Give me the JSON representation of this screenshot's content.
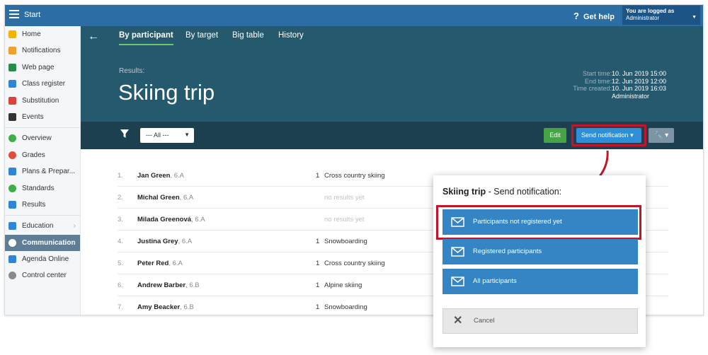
{
  "topbar": {
    "start": "Start",
    "help": "Get help",
    "logged_line1": "You are logged as",
    "logged_line2": "Administrator"
  },
  "sidebar": {
    "items": [
      {
        "label": "Home",
        "color": "#f5b400"
      },
      {
        "label": "Notifications",
        "color": "#f0a030"
      },
      {
        "label": "Web page",
        "color": "#2a8a4a"
      },
      {
        "label": "Class register",
        "color": "#2f86d6"
      },
      {
        "label": "Substitution",
        "color": "#d9453a"
      },
      {
        "label": "Events",
        "color": "#333333"
      },
      {
        "label": "Overview",
        "color": "#3fae49"
      },
      {
        "label": "Grades",
        "color": "#e04b3b"
      },
      {
        "label": "Plans & Prepar...",
        "color": "#2f86d6"
      },
      {
        "label": "Standards",
        "color": "#3fae49"
      },
      {
        "label": "Results",
        "color": "#2f86d6"
      },
      {
        "label": "Education",
        "color": "#2f86d6"
      },
      {
        "label": "Communication",
        "color": "#ffffff"
      },
      {
        "label": "Agenda Online",
        "color": "#2f86d6"
      },
      {
        "label": "Control center",
        "color": "#8a8a8a"
      }
    ]
  },
  "tabs": [
    "By participant",
    "By target",
    "Big table",
    "History"
  ],
  "header": {
    "results_label": "Results:",
    "title": "Skiing trip",
    "meta_labels": [
      "Start time:",
      "End time:",
      "Time created:"
    ],
    "meta_values": [
      "10. Jun 2019 15:00",
      "12. Jun 2019 12:00",
      "10. Jun 2019 16:03",
      "Administrator"
    ]
  },
  "toolbar": {
    "filter_value": "--- All ---",
    "edit": "Edit",
    "send": "Send notification"
  },
  "rows": [
    {
      "n": "1.",
      "name": "Jan Green",
      "cls": ", 6.A",
      "count": "1",
      "result": "Cross country skiing"
    },
    {
      "n": "2.",
      "name": "Michal Green",
      "cls": ", 6.A",
      "count": "",
      "result": "no results yet"
    },
    {
      "n": "3.",
      "name": "Milada Greenová",
      "cls": ", 6.A",
      "count": "",
      "result": "no results yet"
    },
    {
      "n": "4.",
      "name": "Justina Grey",
      "cls": ", 6.A",
      "count": "1",
      "result": "Snowboarding"
    },
    {
      "n": "5.",
      "name": "Peter Red",
      "cls": ", 6.A",
      "count": "1",
      "result": "Cross country skiing"
    },
    {
      "n": "6.",
      "name": "Andrew Barber",
      "cls": ", 6.B",
      "count": "1",
      "result": "Alpine skiing"
    },
    {
      "n": "7.",
      "name": "Amy Beacker",
      "cls": ", 6.B",
      "count": "1",
      "result": "Snowboarding"
    }
  ],
  "popup": {
    "title_bold": "Skiing trip",
    "title_rest": " - Send notification:",
    "options": [
      "Participants not registered yet",
      "Registered participants",
      "All participants"
    ],
    "cancel": "Cancel"
  }
}
